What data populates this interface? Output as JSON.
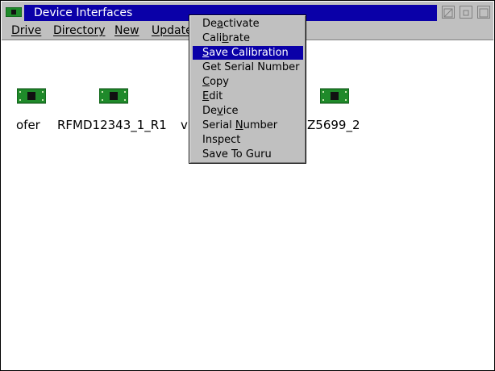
{
  "window": {
    "title": "Device Interfaces"
  },
  "menubar": {
    "items": [
      {
        "pre": "",
        "acc": "D",
        "post": "rive"
      },
      {
        "pre": "",
        "acc": "D",
        "post": "irectory"
      },
      {
        "pre": "",
        "acc": "N",
        "post": "ew"
      },
      {
        "pre": "",
        "acc": "U",
        "post": "pdate"
      }
    ]
  },
  "devices": [
    {
      "label": "ofer"
    },
    {
      "label": "RFMD12343_1_R1"
    },
    {
      "label": "v"
    },
    {
      "label": "Z5699_2"
    }
  ],
  "context_menu": {
    "items": [
      {
        "pre": "De",
        "acc": "a",
        "post": "ctivate",
        "selected": false
      },
      {
        "pre": "Cali",
        "acc": "b",
        "post": "rate",
        "selected": false
      },
      {
        "pre": "",
        "acc": "S",
        "post": "ave Calibration",
        "selected": true
      },
      {
        "pre": "Get Serial Number",
        "acc": "",
        "post": "",
        "selected": false
      },
      {
        "pre": "",
        "acc": "C",
        "post": "opy",
        "selected": false
      },
      {
        "pre": "",
        "acc": "E",
        "post": "dit",
        "selected": false
      },
      {
        "pre": "De",
        "acc": "v",
        "post": "ice",
        "selected": false
      },
      {
        "pre": "Serial ",
        "acc": "N",
        "post": "umber",
        "selected": false
      },
      {
        "pre": "Inspect",
        "acc": "",
        "post": "",
        "selected": false
      },
      {
        "pre": "Save To Guru",
        "acc": "",
        "post": "",
        "selected": false
      }
    ]
  },
  "colors": {
    "title_bg": "#0a00a8",
    "chip_green": "#1f8a2a",
    "selection": "#0a00a8"
  }
}
